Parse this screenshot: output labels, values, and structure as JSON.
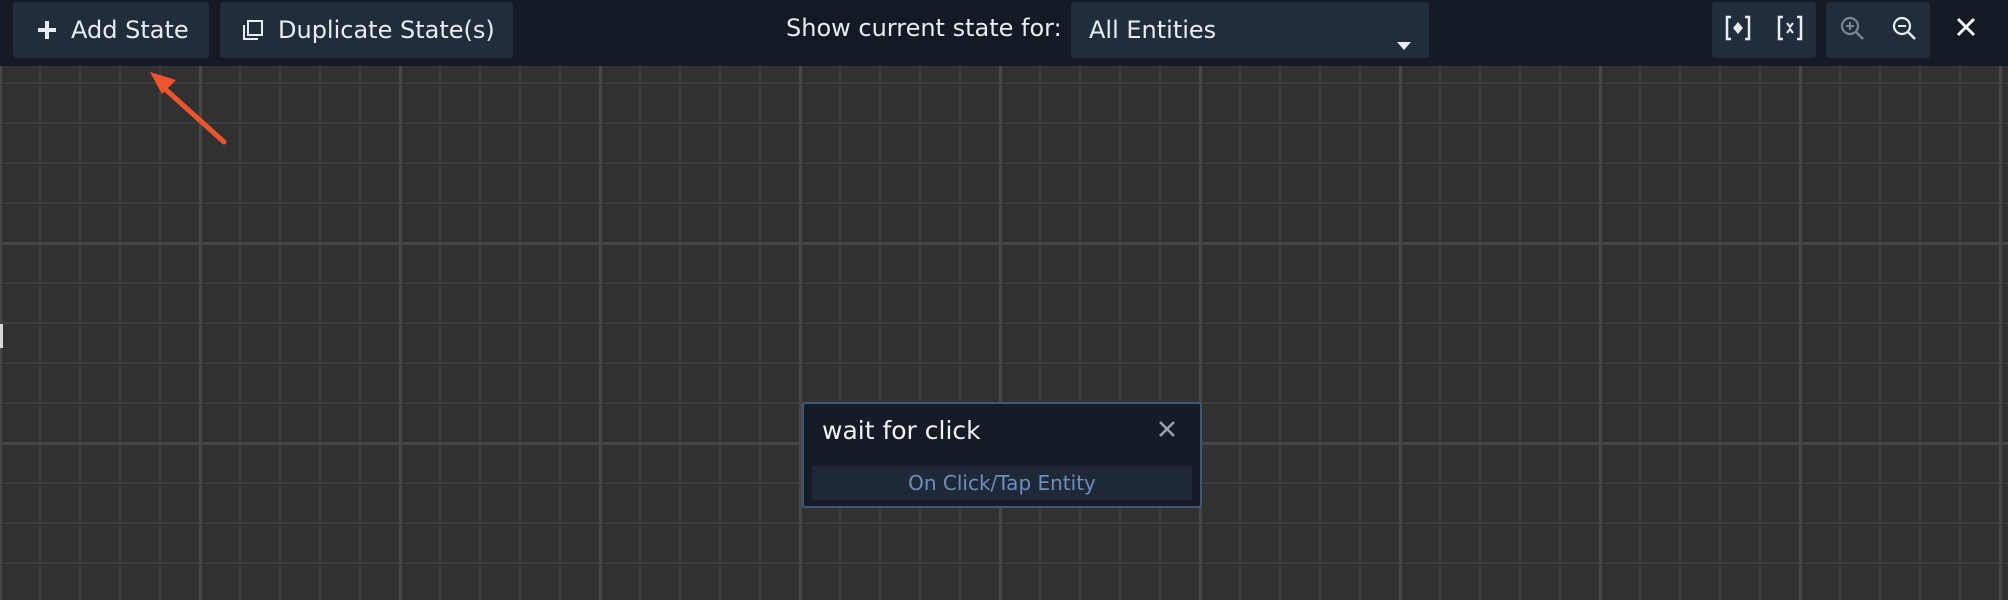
{
  "toolbar": {
    "add_state_label": "Add State",
    "duplicate_label": "Duplicate State(s)",
    "show_state_label": "Show current state for:",
    "entity_select_value": "All Entities",
    "icons": {
      "add": "plus-icon",
      "duplicate": "duplicate-icon",
      "frame_selected": "frame-selected-icon",
      "frame_all": "frame-all-icon",
      "zoom_in": "zoom-in-icon",
      "zoom_out": "zoom-out-icon",
      "close": "close-icon",
      "dropdown": "chevron-down-icon"
    }
  },
  "canvas": {
    "state_node": {
      "title": "wait for click",
      "trigger_label": "On Click/Tap Entity"
    }
  },
  "colors": {
    "toolbar_bg": "#131a24",
    "button_bg": "#222d3c",
    "canvas_bg": "#313131",
    "node_border": "#3f5878",
    "trigger_text": "#6d8fbd",
    "annotation_arrow": "#f0542c"
  }
}
